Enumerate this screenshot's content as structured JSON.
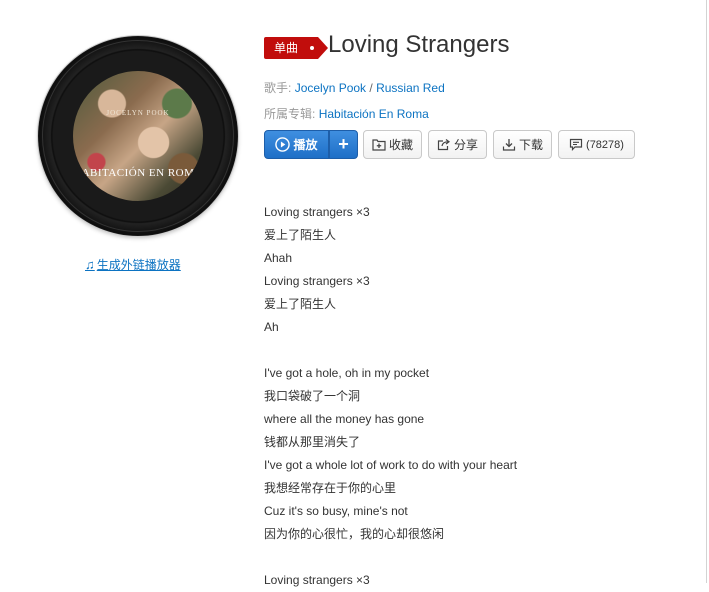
{
  "album_cover": {
    "top_text": "JOCELYN POOK",
    "bottom_text": "HABITACIÓN EN ROMA"
  },
  "external_player_link": "生成外链播放器",
  "song": {
    "badge": "单曲",
    "title": "Loving Strangers",
    "artist_label": "歌手:",
    "artist1": "Jocelyn Pook",
    "artist_sep": " / ",
    "artist2": "Russian Red",
    "album_label": "所属专辑:",
    "album": "Habitación En Roma"
  },
  "actions": {
    "play": "播放",
    "add": "+",
    "collect": "收藏",
    "share": "分享",
    "download": "下载",
    "comments": "(78278)"
  },
  "icons": {
    "play": "play-circle-icon",
    "collect": "add-folder-icon",
    "share": "share-arrow-icon",
    "download": "download-icon",
    "comment": "comment-bubble-icon",
    "note": "music-note-icon"
  },
  "colors": {
    "brand_red": "#c10d0c",
    "link_blue": "#0c73c2",
    "play_blue": "#2a7fd4"
  },
  "lyrics": [
    "Loving strangers ×3",
    "爱上了陌生人",
    "Ahah",
    "Loving strangers ×3",
    "爱上了陌生人",
    "Ah",
    "",
    "I've got a hole, oh in my pocket",
    "我口袋破了一个洞",
    "where all the money has gone",
    "钱都从那里消失了",
    "I've got a whole lot of work to do with your heart",
    "我想经常存在于你的心里",
    "Cuz it's so busy, mine's not",
    "因为你的心很忙，我的心却很悠闲",
    "",
    "Loving strangers ×3"
  ]
}
